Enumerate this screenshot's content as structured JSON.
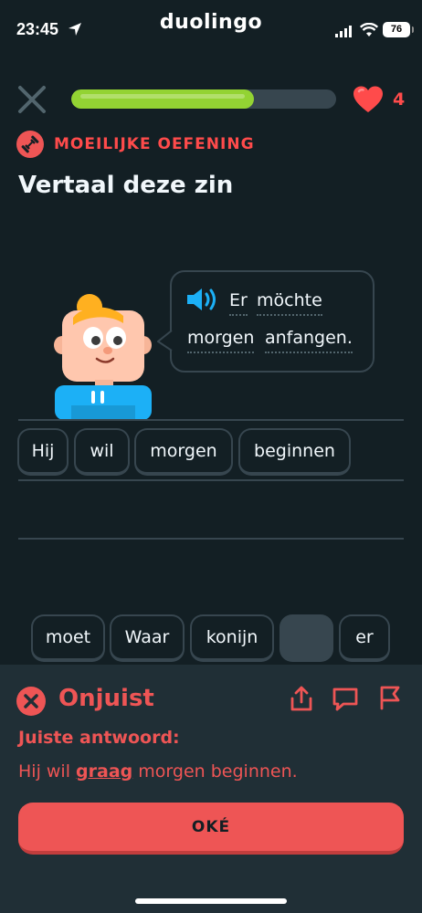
{
  "status_bar": {
    "time": "23:45",
    "battery": "76"
  },
  "app": {
    "name": "duolingo"
  },
  "lesson": {
    "progress": 0.69,
    "hearts": "4"
  },
  "challenge": {
    "type_label": "MOEILIJKE OEFENING",
    "instruction": "Vertaal deze zin",
    "prompt_words": [
      "Er",
      "möchte",
      "morgen",
      "anfangen."
    ]
  },
  "answer": {
    "selected_words": [
      "Hij",
      "wil",
      "morgen",
      "beginnen"
    ]
  },
  "word_bank": [
    "moet",
    "Waar",
    "konijn",
    "",
    "er"
  ],
  "feedback": {
    "status": "Onjuist",
    "correct_label": "Juiste antwoord:",
    "answer_before": "Hij wil ",
    "answer_highlight": "graag",
    "answer_after": " morgen beginnen.",
    "ok_button": "OKÉ"
  },
  "colors": {
    "background": "#131f24",
    "progress_fill": "#93d333",
    "error_red": "#ee5555",
    "heart_red": "#ff4b4b",
    "speaker_blue": "#1cb0f6",
    "panel": "#202f36"
  },
  "icons": [
    "location-arrow-icon",
    "signal-icon",
    "wifi-icon",
    "close-icon",
    "heart-icon",
    "dumbbell-icon",
    "speaker-icon",
    "x-circle-icon",
    "share-icon",
    "comment-icon",
    "flag-icon"
  ]
}
